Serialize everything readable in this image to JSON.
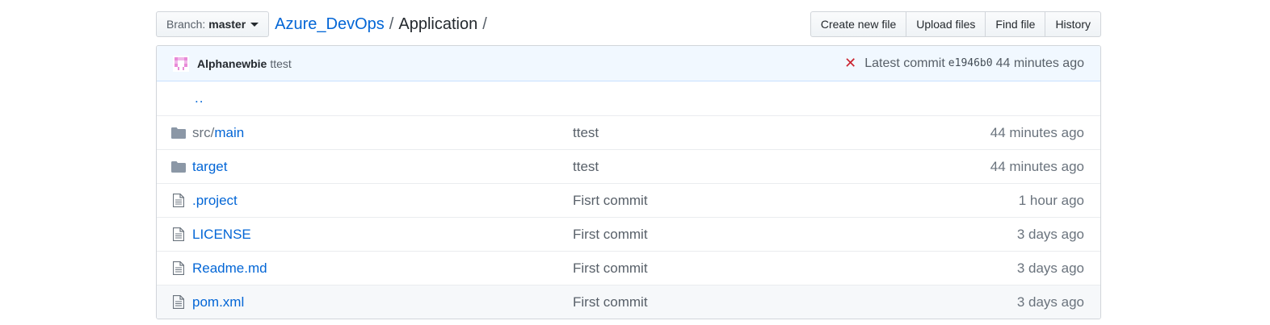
{
  "branch": {
    "prefix": "Branch:",
    "name": "master"
  },
  "breadcrumb": {
    "repo": "Azure_DevOps",
    "sep1": "/",
    "folder": "Application",
    "sep2": "/"
  },
  "actions": {
    "create_new_file": "Create new file",
    "upload_files": "Upload files",
    "find_file": "Find file",
    "history": "History"
  },
  "commit": {
    "author": "Alphanewbie",
    "message": "ttest",
    "status_icon": "x-icon",
    "status_color": "#cb2431",
    "latest_label": "Latest commit",
    "sha": "e1946b0",
    "time": "44 minutes ago"
  },
  "updir": "..",
  "files": [
    {
      "type": "directory",
      "icon": "folder-icon",
      "prefix": "src/",
      "name": "main",
      "message": "ttest",
      "age": "44 minutes ago"
    },
    {
      "type": "directory",
      "icon": "folder-icon",
      "prefix": "",
      "name": "target",
      "message": "ttest",
      "age": "44 minutes ago"
    },
    {
      "type": "file",
      "icon": "file-icon",
      "prefix": "",
      "name": ".project",
      "message": "Fisrt commit",
      "age": "1 hour ago"
    },
    {
      "type": "file",
      "icon": "file-icon",
      "prefix": "",
      "name": "LICENSE",
      "message": "First commit",
      "age": "3 days ago"
    },
    {
      "type": "file",
      "icon": "file-icon",
      "prefix": "",
      "name": "Readme.md",
      "message": "First commit",
      "age": "3 days ago"
    },
    {
      "type": "file",
      "icon": "file-icon",
      "prefix": "",
      "name": "pom.xml",
      "message": "First commit",
      "age": "3 days ago"
    }
  ],
  "colors": {
    "link": "#0366d6",
    "folder_icon": "#79b8ff",
    "file_icon": "#6a737d",
    "commit_bar": "#f1f8ff"
  }
}
